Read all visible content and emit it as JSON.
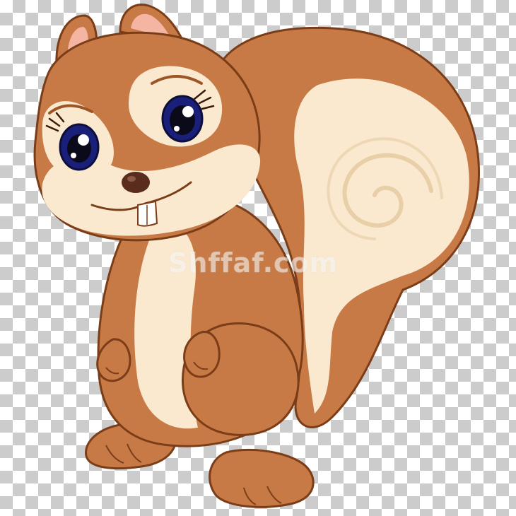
{
  "image": {
    "subject": "cartoon-squirrel",
    "background": "transparency-checkerboard",
    "watermark_text": "Shffaf.com",
    "colors": {
      "fur": "#c77a45",
      "fur_dark": "#9b5526",
      "outline": "#7a3d18",
      "cream": "#fbe9cf",
      "ear_inner": "#f4b5a3",
      "eye_iris": "#1a1f7a",
      "nose": "#5a2c1e",
      "checker_dark": "#cccccc",
      "checker_light": "#ffffff"
    }
  }
}
